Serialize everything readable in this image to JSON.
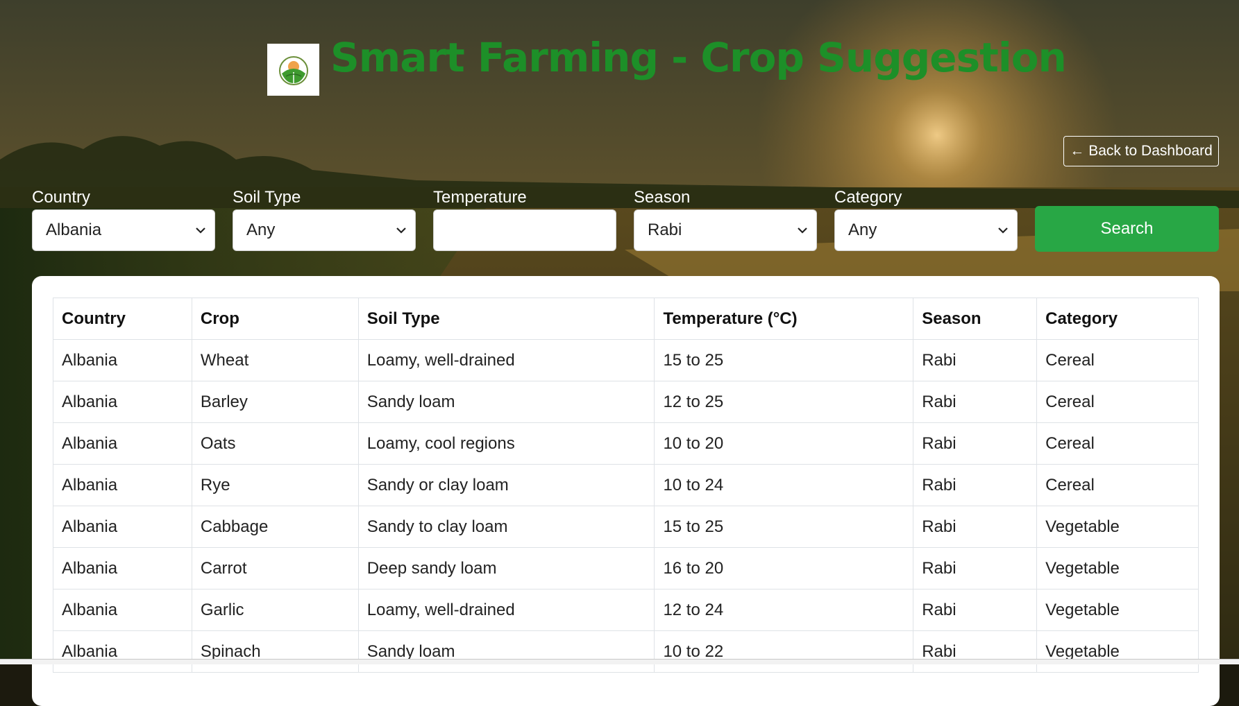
{
  "header": {
    "title": "Smart Farming - Crop Suggestion",
    "back_label": "Back to Dashboard",
    "back_arrow": "←"
  },
  "filters": {
    "country": {
      "label": "Country",
      "value": "Albania"
    },
    "soil": {
      "label": "Soil Type",
      "value": "Any"
    },
    "temperature": {
      "label": "Temperature",
      "value": ""
    },
    "season": {
      "label": "Season",
      "value": "Rabi"
    },
    "category": {
      "label": "Category",
      "value": "Any"
    },
    "search_label": "Search"
  },
  "table": {
    "headers": [
      "Country",
      "Crop",
      "Soil Type",
      "Temperature (°C)",
      "Season",
      "Category"
    ],
    "rows": [
      [
        "Albania",
        "Wheat",
        "Loamy, well-drained",
        "15 to 25",
        "Rabi",
        "Cereal"
      ],
      [
        "Albania",
        "Barley",
        "Sandy loam",
        "12 to 25",
        "Rabi",
        "Cereal"
      ],
      [
        "Albania",
        "Oats",
        "Loamy, cool regions",
        "10 to 20",
        "Rabi",
        "Cereal"
      ],
      [
        "Albania",
        "Rye",
        "Sandy or clay loam",
        "10 to 24",
        "Rabi",
        "Cereal"
      ],
      [
        "Albania",
        "Cabbage",
        "Sandy to clay loam",
        "15 to 25",
        "Rabi",
        "Vegetable"
      ],
      [
        "Albania",
        "Carrot",
        "Deep sandy loam",
        "16 to 20",
        "Rabi",
        "Vegetable"
      ],
      [
        "Albania",
        "Garlic",
        "Loamy, well-drained",
        "12 to 24",
        "Rabi",
        "Vegetable"
      ],
      [
        "Albania",
        "Spinach",
        "Sandy loam",
        "10 to 22",
        "Rabi",
        "Vegetable"
      ]
    ]
  },
  "colors": {
    "title_green": "#1d8f28",
    "search_green": "#28a745"
  },
  "icons": {
    "logo": "farm-logo-icon",
    "dropdown": "chevron-down-icon"
  }
}
